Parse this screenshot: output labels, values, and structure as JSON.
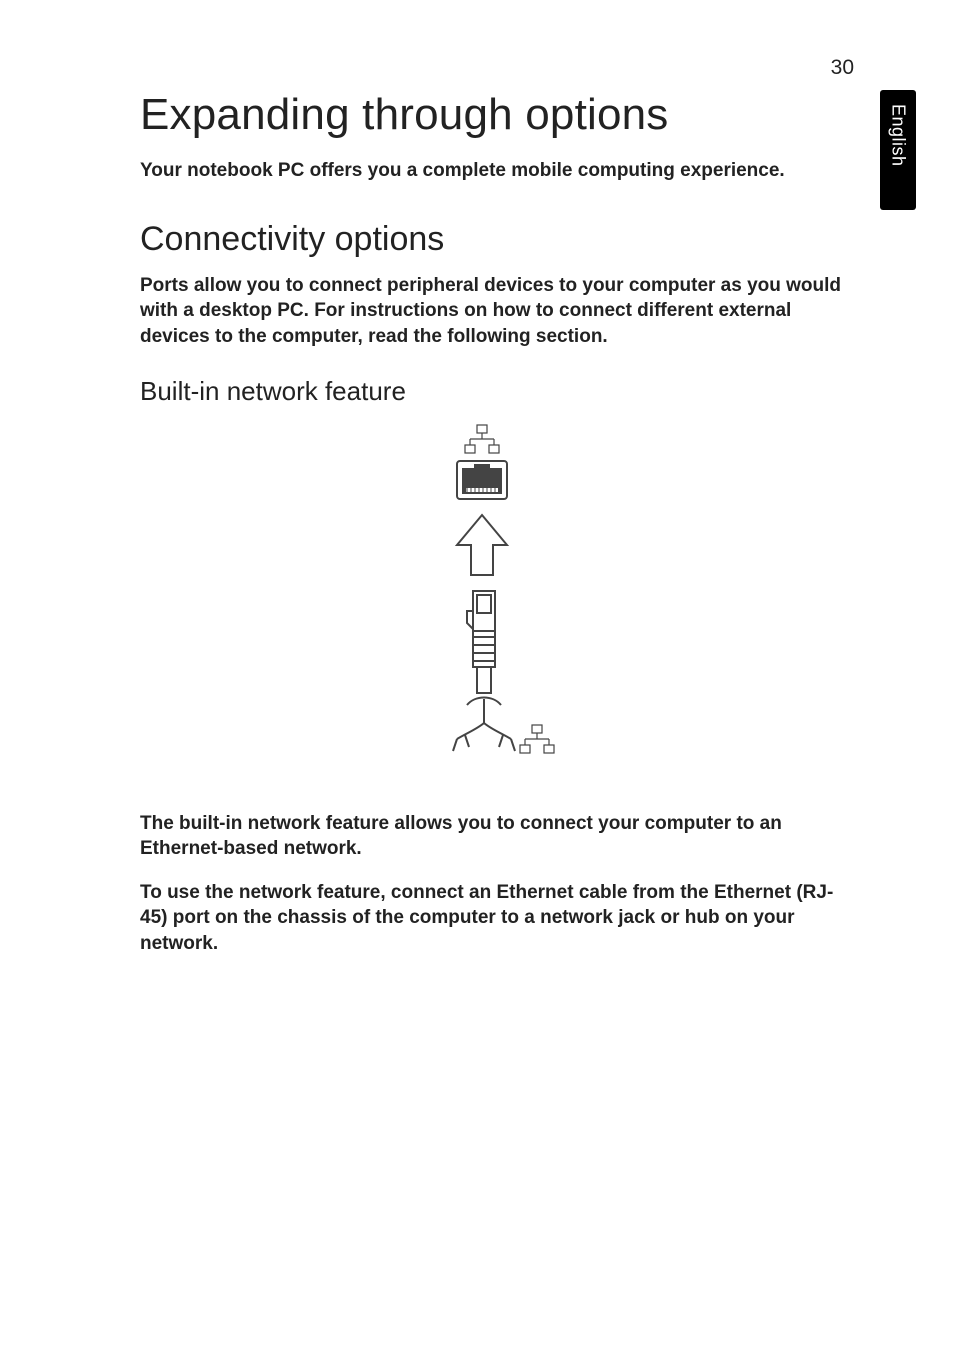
{
  "page_number": "30",
  "side_tab_label": "English",
  "title": "Expanding through options",
  "intro": "Your notebook PC offers you a complete mobile computing experience.",
  "section_heading": "Connectivity options",
  "section_text": "Ports allow you to connect peripheral devices to your computer as you would with a desktop PC. For instructions on how to connect different external devices to the computer, read the following section.",
  "subsection_heading": "Built-in network feature",
  "body1": "The built-in network feature allows you to connect your computer to an Ethernet-based network.",
  "body2": "To use the network feature, connect an Ethernet cable from the Ethernet (RJ-45) port on the chassis of the computer to a network jack or hub on your network."
}
